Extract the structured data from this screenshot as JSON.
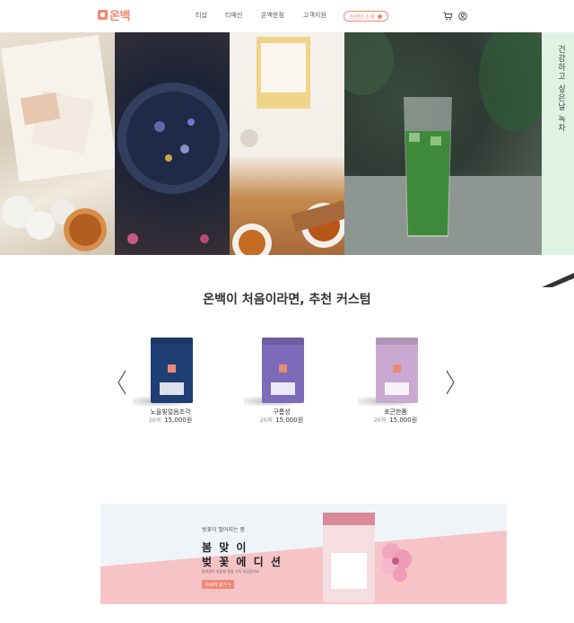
{
  "header": {
    "logo_text": "온백",
    "nav": [
      "티샵",
      "티매신",
      "온백한점",
      "고객지원"
    ],
    "brand_button": "브랜드소개",
    "icons": [
      "cart-icon",
      "user-icon"
    ]
  },
  "hero": {
    "caption": "건강하고 싶은날 녹차",
    "panels": [
      "tea-book-photo",
      "blue-flower-tea-photo",
      "tea-spread-photo",
      "matcha-latte-photo"
    ]
  },
  "section": {
    "title": "온백이 처음이라면, 추천 커스텀"
  },
  "products": [
    {
      "name": "노을빛얼음조각",
      "count": "20개",
      "price": "15,000원",
      "color": "#1f3f74"
    },
    {
      "name": "구름성",
      "count": "20개",
      "price": "15,000원",
      "color": "#7b6bb8"
    },
    {
      "name": "포근한품",
      "count": "20개",
      "price": "15,000원",
      "color": "#c9a9d2"
    }
  ],
  "banner": {
    "subtitle": "벚꽃이 떨어지는 봄",
    "title_line1": "봄 맞 이",
    "title_line2": "벚 꽃 에 디 션",
    "description": "봄내음이 벚꽃향 을을 가득 머금었어요",
    "button": "자세히 보기"
  },
  "colors": {
    "accent": "#f08873",
    "mint": "#dff3e4",
    "banner_pink": "#f6c3c7"
  }
}
